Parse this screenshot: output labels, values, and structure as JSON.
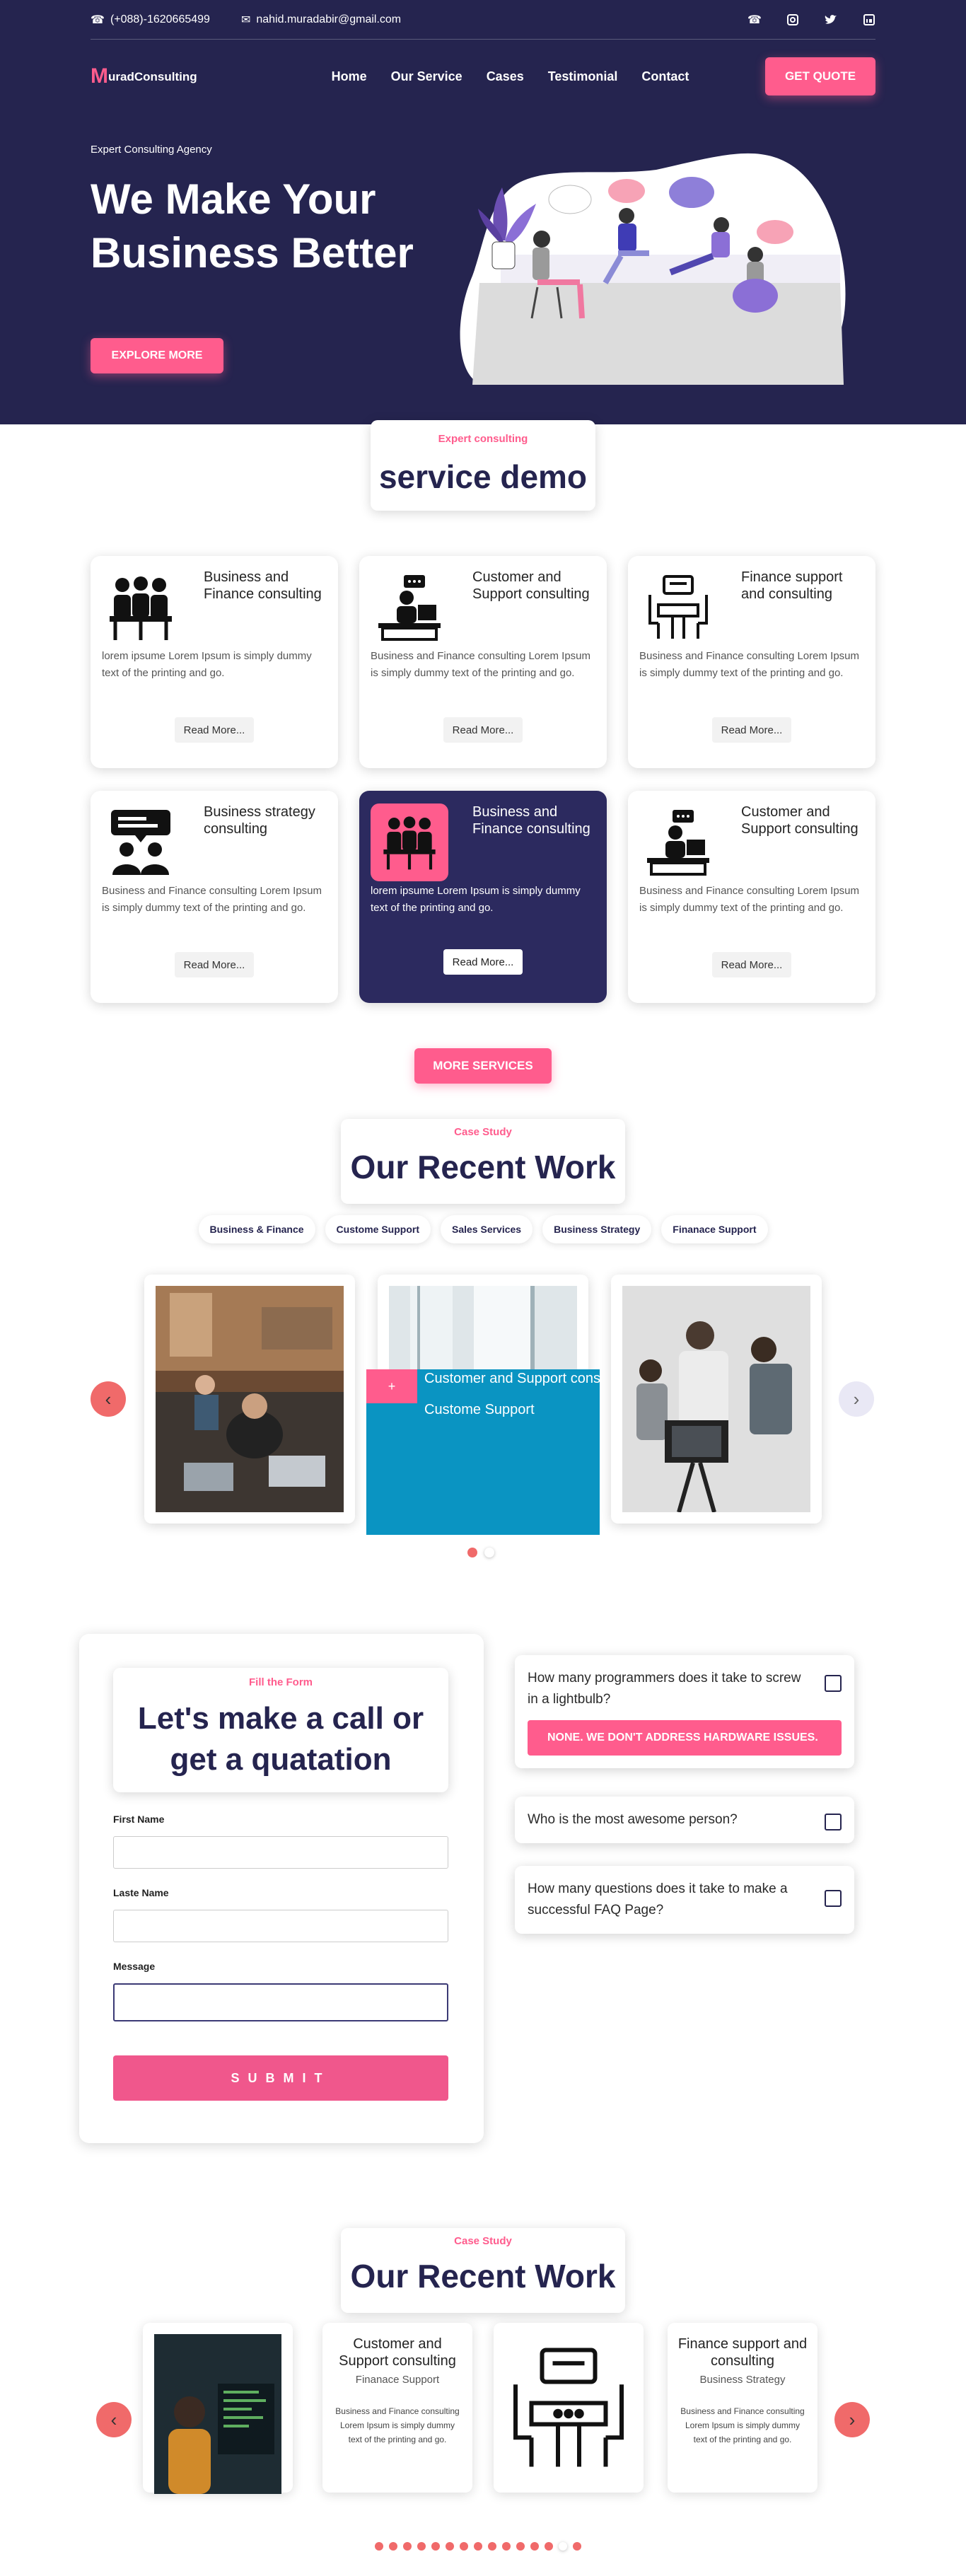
{
  "topbar": {
    "phone": "(+088)-1620665499",
    "email": "nahid.muradabir@gmail.com"
  },
  "nav": {
    "logo_initial": "M",
    "logo_rest": "uradConsulting",
    "items": [
      "Home",
      "Our Service",
      "Cases",
      "Testimonial",
      "Contact"
    ],
    "cta": "GET QUOTE"
  },
  "hero": {
    "eyebrow": "Expert Consulting Agency",
    "headline": "We Make Your Business Better",
    "cta": "EXPLORE MORE"
  },
  "services": {
    "eyebrow": "Expert consulting",
    "title": "service demo",
    "read_more": "Read More...",
    "more": "MORE SERVICES",
    "cards": [
      {
        "title": "Business and Finance consulting",
        "text": "lorem ipsume Lorem Ipsum is simply dummy text of the printing and go.",
        "icon": "meeting-icon"
      },
      {
        "title": "Customer and Support consulting",
        "text": "Business and Finance consulting Lorem Ipsum is simply dummy text of the printing and go.",
        "icon": "support-desk-icon"
      },
      {
        "title": "Finance support and consulting",
        "text": "Business and Finance consulting Lorem Ipsum is simply dummy text of the printing and go.",
        "icon": "finance-table-icon"
      },
      {
        "title": "Business strategy consulting",
        "text": "Business and Finance consulting Lorem Ipsum is simply dummy text of the printing and go.",
        "icon": "strategy-chat-icon"
      },
      {
        "title": "Business and Finance consulting",
        "text": "lorem ipsume Lorem Ipsum is simply dummy text of the printing and go.",
        "icon": "meeting-icon"
      },
      {
        "title": "Customer and Support consulting",
        "text": "Business and Finance consulting Lorem Ipsum is simply dummy text of the printing and go.",
        "icon": "support-desk-icon"
      }
    ]
  },
  "work": {
    "eyebrow": "Case Study",
    "title": "Our Recent Work",
    "filters": [
      "Business & Finance",
      "Custome Support",
      "Sales Services",
      "Business Strategy",
      "Finanace Support"
    ],
    "overlay_title": "Customer and Support consulting",
    "overlay_sub": "Custome Support",
    "overlay_plus": "+"
  },
  "form": {
    "eyebrow": "Fill the Form",
    "title": "Let's make a call or get a quatation",
    "first": "First Name",
    "last": "Laste Name",
    "message": "Message",
    "submit": "SUBMIT"
  },
  "faq": [
    {
      "q": "How many programmers does it take to screw in a lightbulb?",
      "a": "NONE. WE DON'T ADDRESS HARDWARE ISSUES."
    },
    {
      "q": "Who is the most awesome person?"
    },
    {
      "q": "How many questions does it take to make a successful FAQ Page?"
    }
  ],
  "work2": {
    "eyebrow": "Case Study",
    "title": "Our Recent Work",
    "items": [
      {
        "title": "Customer and Support consulting",
        "sub": "Finanace Support",
        "text": "Business and Finance consulting Lorem Ipsum is simply dummy text of the printing and go."
      },
      {
        "title": "Finance support and consulting",
        "sub": "Business Strategy",
        "text": "Business and Finance consulting Lorem Ipsum is simply dummy text of the printing and go."
      }
    ]
  },
  "colors": {
    "navy": "#25244f",
    "pink": "#ff5c8d",
    "teal": "#0a94c2"
  }
}
